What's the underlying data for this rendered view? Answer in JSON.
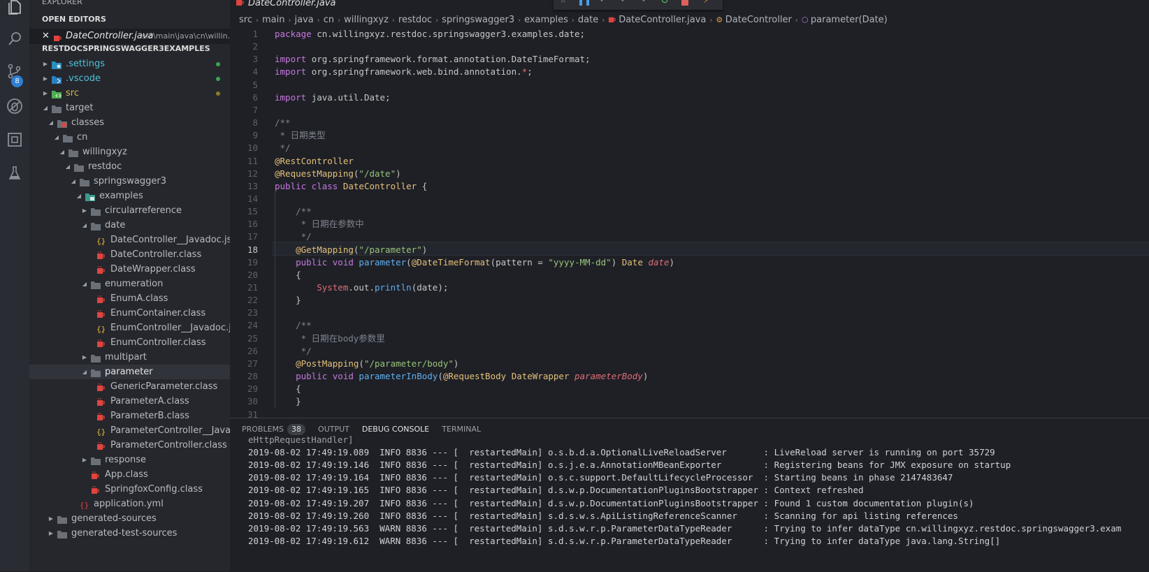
{
  "activity_bar": {
    "icons": [
      "files-icon",
      "search-icon",
      "source-control-icon",
      "debug-icon",
      "extensions-icon",
      "test-icon"
    ],
    "scm_badge": "8"
  },
  "sidebar": {
    "explorer_title": "EXPLORER",
    "open_editors_title": "OPEN EDITORS",
    "open_editor": {
      "name": "DateController.java",
      "path": "src\\main\\java\\cn\\willin..."
    },
    "project_title": "RESTDOCSPRINGSWAGGER3EXAMPLES",
    "tree": [
      {
        "label": ".settings",
        "depth": 0,
        "kind": "folder-settings",
        "twisty": "closed",
        "dot": "#3aa655"
      },
      {
        "label": ".vscode",
        "depth": 0,
        "kind": "folder-vscode",
        "twisty": "closed",
        "dot": "#3aa655"
      },
      {
        "label": "src",
        "depth": 0,
        "kind": "folder-src",
        "twisty": "closed",
        "dot": "#8a7a2a"
      },
      {
        "label": "target",
        "depth": 0,
        "kind": "folder",
        "twisty": "open"
      },
      {
        "label": "classes",
        "depth": 1,
        "kind": "folder-red",
        "twisty": "open"
      },
      {
        "label": "cn",
        "depth": 2,
        "kind": "folder",
        "twisty": "open"
      },
      {
        "label": "willingxyz",
        "depth": 3,
        "kind": "folder",
        "twisty": "open"
      },
      {
        "label": "restdoc",
        "depth": 4,
        "kind": "folder",
        "twisty": "open"
      },
      {
        "label": "springswagger3",
        "depth": 5,
        "kind": "folder",
        "twisty": "open"
      },
      {
        "label": "examples",
        "depth": 6,
        "kind": "folder-teal",
        "twisty": "open"
      },
      {
        "label": "circularreference",
        "depth": 7,
        "kind": "folder",
        "twisty": "closed"
      },
      {
        "label": "date",
        "depth": 7,
        "kind": "folder",
        "twisty": "open"
      },
      {
        "label": "DateController__Javadoc.json",
        "depth": 8,
        "kind": "json",
        "twisty": ""
      },
      {
        "label": "DateController.class",
        "depth": 8,
        "kind": "class",
        "twisty": ""
      },
      {
        "label": "DateWrapper.class",
        "depth": 8,
        "kind": "class",
        "twisty": ""
      },
      {
        "label": "enumeration",
        "depth": 7,
        "kind": "folder",
        "twisty": "open"
      },
      {
        "label": "EnumA.class",
        "depth": 8,
        "kind": "class",
        "twisty": ""
      },
      {
        "label": "EnumContainer.class",
        "depth": 8,
        "kind": "class",
        "twisty": ""
      },
      {
        "label": "EnumController__Javadoc.json",
        "depth": 8,
        "kind": "json",
        "twisty": ""
      },
      {
        "label": "EnumController.class",
        "depth": 8,
        "kind": "class",
        "twisty": ""
      },
      {
        "label": "multipart",
        "depth": 7,
        "kind": "folder",
        "twisty": "closed"
      },
      {
        "label": "parameter",
        "depth": 7,
        "kind": "folder",
        "twisty": "open",
        "selected": true
      },
      {
        "label": "GenericParameter.class",
        "depth": 8,
        "kind": "class",
        "twisty": ""
      },
      {
        "label": "ParameterA.class",
        "depth": 8,
        "kind": "class",
        "twisty": ""
      },
      {
        "label": "ParameterB.class",
        "depth": 8,
        "kind": "class",
        "twisty": ""
      },
      {
        "label": "ParameterController__Javado...",
        "depth": 8,
        "kind": "json",
        "twisty": ""
      },
      {
        "label": "ParameterController.class",
        "depth": 8,
        "kind": "class",
        "twisty": ""
      },
      {
        "label": "response",
        "depth": 7,
        "kind": "folder",
        "twisty": "closed"
      },
      {
        "label": "App.class",
        "depth": 7,
        "kind": "class",
        "twisty": ""
      },
      {
        "label": "SpringfoxConfig.class",
        "depth": 7,
        "kind": "class",
        "twisty": ""
      },
      {
        "label": "application.yml",
        "depth": 5,
        "kind": "yml",
        "twisty": ""
      },
      {
        "label": "generated-sources",
        "depth": 1,
        "kind": "folder",
        "twisty": "closed"
      },
      {
        "label": "generated-test-sources",
        "depth": 1,
        "kind": "folder",
        "twisty": "closed"
      }
    ]
  },
  "editor": {
    "tab_title": "DateController.java",
    "breadcrumb": [
      "src",
      "main",
      "java",
      "cn",
      "willingxyz",
      "restdoc",
      "springswagger3",
      "examples",
      "date",
      "DateController.java",
      "DateController",
      "parameter(Date)"
    ],
    "current_line": 18,
    "lines": [
      {
        "n": "1",
        "tokens": [
          [
            "kw",
            "package "
          ],
          [
            "",
            "cn.willingxyz.restdoc.springswagger3.examples.date;"
          ]
        ]
      },
      {
        "n": "2",
        "tokens": []
      },
      {
        "n": "3",
        "tokens": [
          [
            "kw",
            "import "
          ],
          [
            "",
            "org.springframework.format.annotation.DateTimeFormat;"
          ]
        ]
      },
      {
        "n": "4",
        "tokens": [
          [
            "kw",
            "import "
          ],
          [
            "",
            "org.springframework.web.bind.annotation."
          ],
          [
            "red",
            "*"
          ],
          [
            "",
            ";"
          ]
        ]
      },
      {
        "n": "5",
        "tokens": []
      },
      {
        "n": "6",
        "tokens": [
          [
            "kw",
            "import "
          ],
          [
            "",
            "java.util.Date;"
          ]
        ]
      },
      {
        "n": "7",
        "tokens": []
      },
      {
        "n": "8",
        "tokens": [
          [
            "cm",
            "/**"
          ]
        ]
      },
      {
        "n": "9",
        "tokens": [
          [
            "cm",
            " * 日期类型"
          ]
        ]
      },
      {
        "n": "10",
        "tokens": [
          [
            "cm",
            " */"
          ]
        ]
      },
      {
        "n": "11",
        "tokens": [
          [
            "ann",
            "@RestController"
          ]
        ]
      },
      {
        "n": "12",
        "tokens": [
          [
            "ann",
            "@RequestMapping"
          ],
          [
            "",
            "("
          ],
          [
            "str",
            "\"/date\""
          ],
          [
            "",
            ")"
          ]
        ]
      },
      {
        "n": "13",
        "tokens": [
          [
            "kw",
            "public class "
          ],
          [
            "ty",
            "DateController "
          ],
          [
            "",
            "{"
          ]
        ]
      },
      {
        "n": "14",
        "tokens": []
      },
      {
        "n": "15",
        "tokens": [
          [
            "cm",
            "    /**"
          ]
        ]
      },
      {
        "n": "16",
        "tokens": [
          [
            "cm",
            "     * 日期在参数中"
          ]
        ]
      },
      {
        "n": "17",
        "tokens": [
          [
            "cm",
            "     */"
          ]
        ]
      },
      {
        "n": "18",
        "tokens": [
          [
            "ann",
            "    @GetMapping"
          ],
          [
            "",
            "("
          ],
          [
            "str",
            "\"/parameter\""
          ],
          [
            "",
            ")"
          ]
        ]
      },
      {
        "n": "19",
        "tokens": [
          [
            "kw",
            "    public void "
          ],
          [
            "fn",
            "parameter"
          ],
          [
            "",
            "("
          ],
          [
            "ann",
            "@DateTimeFormat"
          ],
          [
            "",
            "(pattern = "
          ],
          [
            "str",
            "\"yyyy-MM-dd\""
          ],
          [
            "",
            ") "
          ],
          [
            "ty",
            "Date "
          ],
          [
            "prm",
            "date"
          ],
          [
            "",
            ")"
          ]
        ]
      },
      {
        "n": "20",
        "tokens": [
          [
            "",
            "    {"
          ]
        ]
      },
      {
        "n": "21",
        "tokens": [
          [
            "red",
            "        System"
          ],
          [
            "",
            ".out."
          ],
          [
            "fn",
            "println"
          ],
          [
            "",
            "(date);"
          ]
        ]
      },
      {
        "n": "22",
        "tokens": [
          [
            "",
            "    }"
          ]
        ]
      },
      {
        "n": "23",
        "tokens": []
      },
      {
        "n": "24",
        "tokens": [
          [
            "cm",
            "    /**"
          ]
        ]
      },
      {
        "n": "25",
        "tokens": [
          [
            "cm",
            "     * 日期在body参数里"
          ]
        ]
      },
      {
        "n": "26",
        "tokens": [
          [
            "cm",
            "     */"
          ]
        ]
      },
      {
        "n": "27",
        "tokens": [
          [
            "ann",
            "    @PostMapping"
          ],
          [
            "",
            "("
          ],
          [
            "str",
            "\"/parameter/body\""
          ],
          [
            "",
            ")"
          ]
        ]
      },
      {
        "n": "28",
        "tokens": [
          [
            "kw",
            "    public void "
          ],
          [
            "fn",
            "parameterInBody"
          ],
          [
            "",
            "("
          ],
          [
            "ann",
            "@RequestBody "
          ],
          [
            "ty",
            "DateWrapper "
          ],
          [
            "prm",
            "parameterBody"
          ],
          [
            "",
            ")"
          ]
        ]
      },
      {
        "n": "29",
        "tokens": [
          [
            "",
            "    {"
          ]
        ]
      },
      {
        "n": "30",
        "tokens": [
          [
            "",
            "    }"
          ]
        ]
      },
      {
        "n": "31",
        "tokens": []
      }
    ]
  },
  "panel": {
    "tabs": [
      {
        "label": "PROBLEMS",
        "badge": "38",
        "active": false
      },
      {
        "label": "OUTPUT",
        "active": false
      },
      {
        "label": "DEBUG CONSOLE",
        "active": true
      },
      {
        "label": "TERMINAL",
        "active": false
      }
    ],
    "console_partial": "eHttpRequestHandler]",
    "console_lines": [
      "2019-08-02 17:49:19.089  INFO 8836 --- [  restartedMain] o.s.b.d.a.OptionalLiveReloadServer       : LiveReload server is running on port 35729",
      "2019-08-02 17:49:19.146  INFO 8836 --- [  restartedMain] o.s.j.e.a.AnnotationMBeanExporter        : Registering beans for JMX exposure on startup",
      "2019-08-02 17:49:19.164  INFO 8836 --- [  restartedMain] o.s.c.support.DefaultLifecycleProcessor  : Starting beans in phase 2147483647",
      "2019-08-02 17:49:19.165  INFO 8836 --- [  restartedMain] d.s.w.p.DocumentationPluginsBootstrapper : Context refreshed",
      "2019-08-02 17:49:19.207  INFO 8836 --- [  restartedMain] d.s.w.p.DocumentationPluginsBootstrapper : Found 1 custom documentation plugin(s)",
      "2019-08-02 17:49:19.260  INFO 8836 --- [  restartedMain] s.d.s.w.s.ApiListingReferenceScanner     : Scanning for api listing references",
      "2019-08-02 17:49:19.563  WARN 8836 --- [  restartedMain] s.d.s.w.r.p.ParameterDataTypeReader      : Trying to infer dataType cn.willingxyz.restdoc.springswagger3.exam",
      "2019-08-02 17:49:19.612  WARN 8836 --- [  restartedMain] s.d.s.w.r.p.ParameterDataTypeReader      : Trying to infer dataType java.lang.String[]"
    ]
  }
}
